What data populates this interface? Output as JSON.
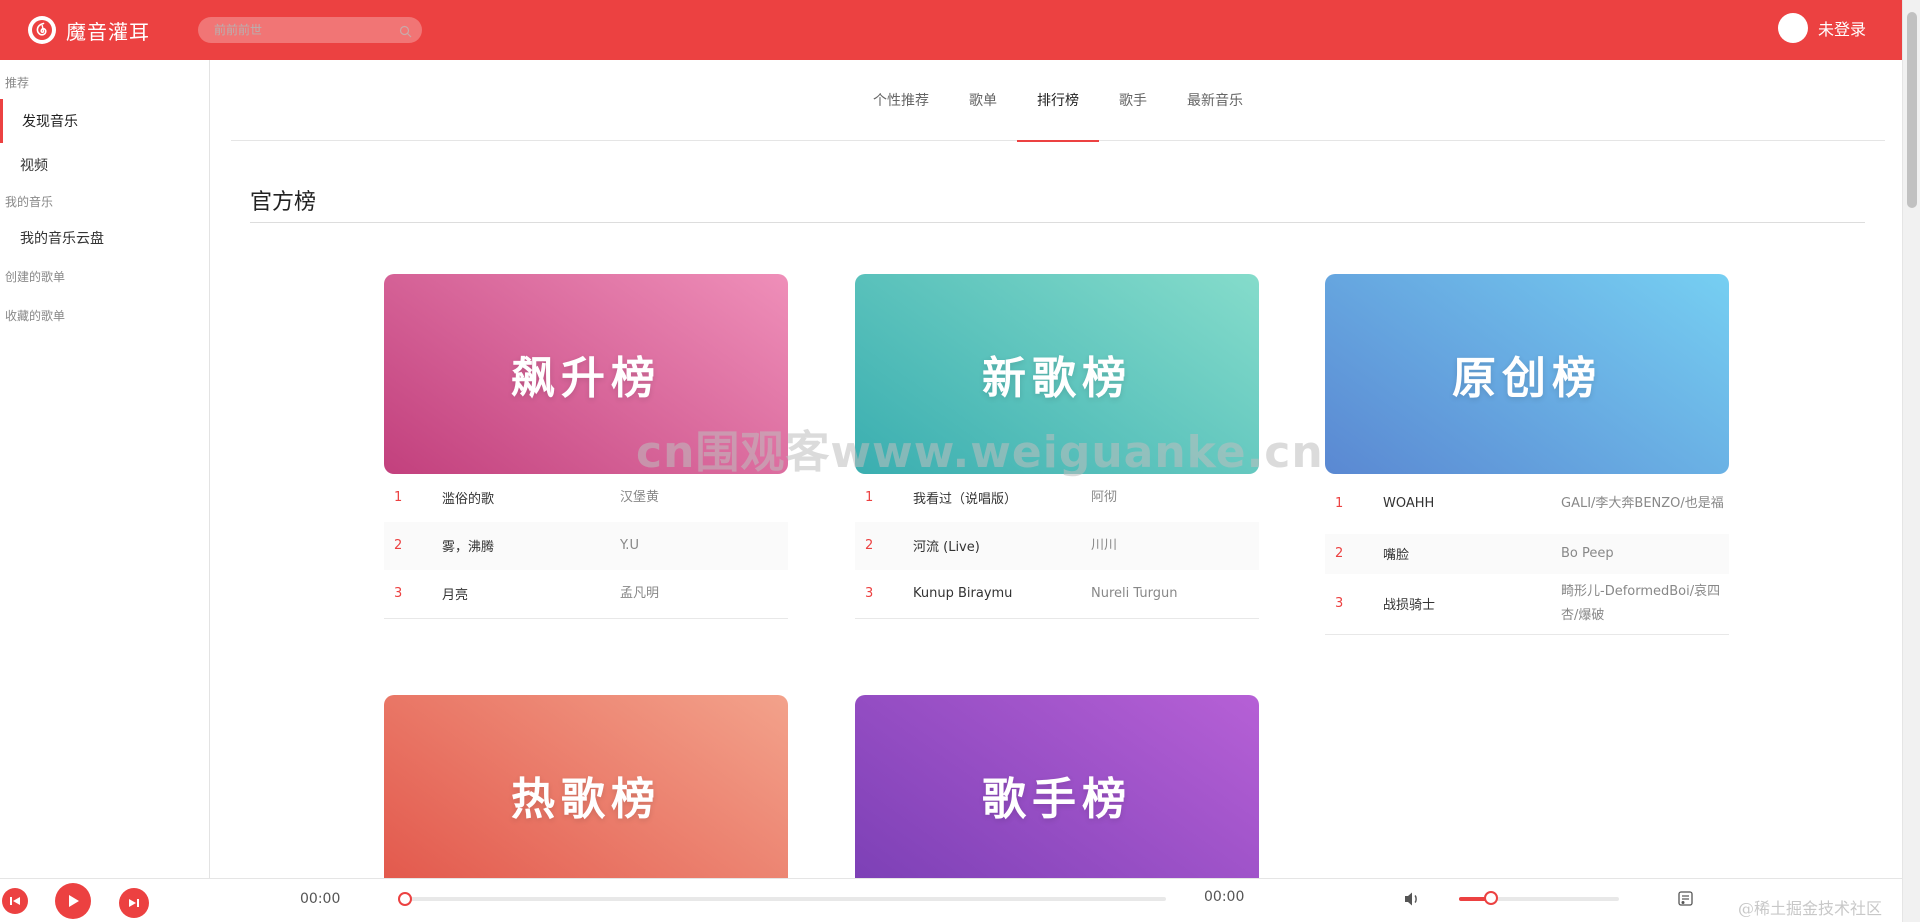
{
  "app": {
    "title": "魔音灌耳",
    "brand_color": "#ec4141"
  },
  "search": {
    "placeholder": "前前前世",
    "icon": "search-icon"
  },
  "user": {
    "login_text": "未登录"
  },
  "sidebar": {
    "groups": [
      {
        "label": "推荐",
        "items": [
          {
            "label": "发现音乐",
            "active": true
          },
          {
            "label": "视频"
          }
        ]
      },
      {
        "label": "我的音乐",
        "items": [
          {
            "label": "我的音乐云盘"
          }
        ]
      },
      {
        "label": "创建的歌单",
        "items": []
      },
      {
        "label": "收藏的歌单",
        "items": []
      }
    ]
  },
  "tabs": [
    {
      "label": "个性推荐"
    },
    {
      "label": "歌单"
    },
    {
      "label": "排行榜",
      "active": true
    },
    {
      "label": "歌手"
    },
    {
      "label": "最新音乐"
    }
  ],
  "section": {
    "title": "官方榜"
  },
  "charts": [
    {
      "name": "飙升榜",
      "colors": [
        "#c2407d",
        "#ef8fb9"
      ],
      "tracks": [
        {
          "rank": "1",
          "song": "滥俗的歌",
          "artist": "汉堡黄"
        },
        {
          "rank": "2",
          "song": "雾，沸腾",
          "artist": "Y.U"
        },
        {
          "rank": "3",
          "song": "月亮",
          "artist": "孟凡明"
        }
      ]
    },
    {
      "name": "新歌榜",
      "colors": [
        "#3aaeb0",
        "#85dccb"
      ],
      "tracks": [
        {
          "rank": "1",
          "song": "我看过（说唱版）",
          "artist": "阿彻"
        },
        {
          "rank": "2",
          "song": "河流 (Live)",
          "artist": "川川"
        },
        {
          "rank": "3",
          "song": "Kunup Biraymu",
          "artist": "Nureli Turgun"
        }
      ]
    },
    {
      "name": "原创榜",
      "colors": [
        "#5a88d2",
        "#76cff2"
      ],
      "tracks": [
        {
          "rank": "1",
          "song": "WOAHH",
          "artist": "GALI/李大奔BENZO/也是福"
        },
        {
          "rank": "2",
          "song": "嘴脸",
          "artist": "Bo Peep"
        },
        {
          "rank": "3",
          "song": "战损骑士",
          "artist": "畸形儿-DeformedBoi/哀四杏/爆破"
        }
      ]
    },
    {
      "name": "热歌榜",
      "colors": [
        "#e2574b",
        "#f3a28b"
      ],
      "tracks": []
    },
    {
      "name": "歌手榜",
      "colors": [
        "#7b3fb5",
        "#b660d6"
      ],
      "tracks": []
    }
  ],
  "watermark": "cn围观客www.weiguanke.cn",
  "player": {
    "current_time": "00:00",
    "total_time": "00:00",
    "progress": 0,
    "volume": 0.2
  },
  "credit": "@稀土掘金技术社区"
}
